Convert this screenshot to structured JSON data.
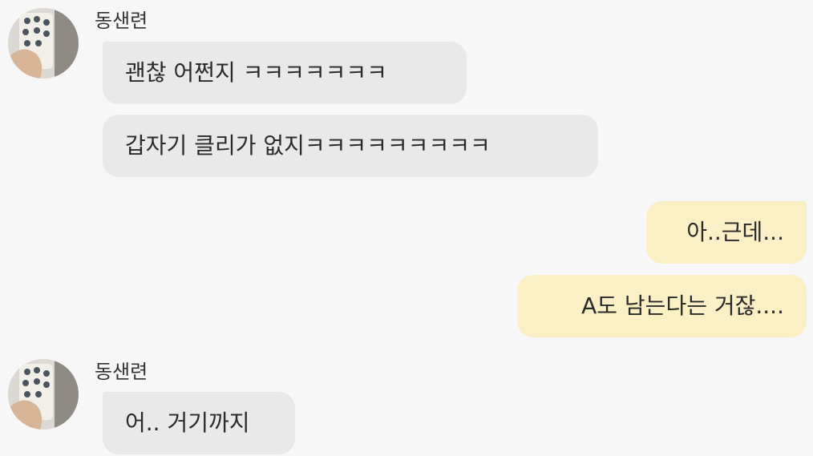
{
  "chat": {
    "groups": [
      {
        "side": "left",
        "sender": "동샌련",
        "avatar_icon": "profile-photo-icon",
        "messages": [
          "괜찮 어쩐지 ㅋㅋㅋㅋㅋㅋㅋ",
          "갑자기 클리가 없지ㅋㅋㅋㅋㅋㅋㅋㅋㅋ"
        ]
      },
      {
        "side": "right",
        "messages": [
          "아..근데...",
          "A도 남는다는 거잖...."
        ]
      },
      {
        "side": "left",
        "sender": "동샌련",
        "avatar_icon": "profile-photo-icon",
        "messages": [
          "어.. 거기까지"
        ]
      }
    ]
  },
  "colors": {
    "background": "#f7f7f7",
    "incoming_bubble": "#e9e9e9",
    "outgoing_bubble": "#fbefc6"
  }
}
